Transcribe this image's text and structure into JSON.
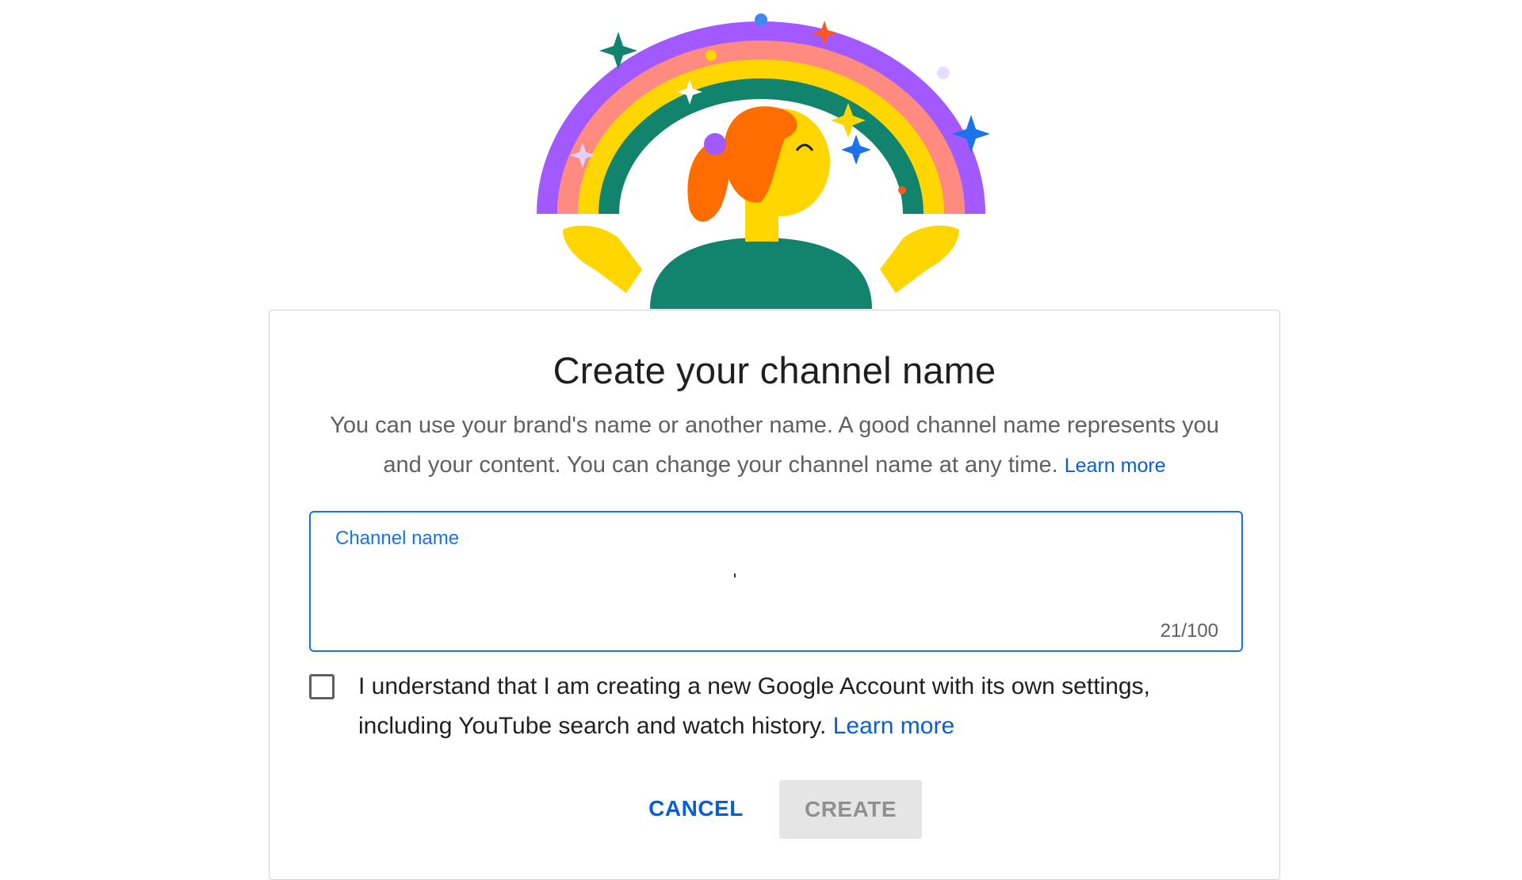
{
  "dialog": {
    "title": "Create your channel name",
    "description": "You can use your brand's name or another name. A good channel name represents you and your content. You can change your channel name at any time.",
    "description_link": "Learn more",
    "field": {
      "label": "Channel name",
      "value": "",
      "counter": "21/100"
    },
    "checkbox": {
      "checked": false,
      "text": "I understand that I am creating a new Google Account with its own settings, including YouTube search and watch history.",
      "link": "Learn more"
    },
    "buttons": {
      "cancel": "CANCEL",
      "create": "CREATE"
    }
  },
  "colors": {
    "link": "#065fd4",
    "field_border": "#1a73e8",
    "disabled_button_bg": "#e5e5e5",
    "disabled_button_text": "#909090"
  },
  "illustration": {
    "icon": "rainbow-person-illustration"
  }
}
